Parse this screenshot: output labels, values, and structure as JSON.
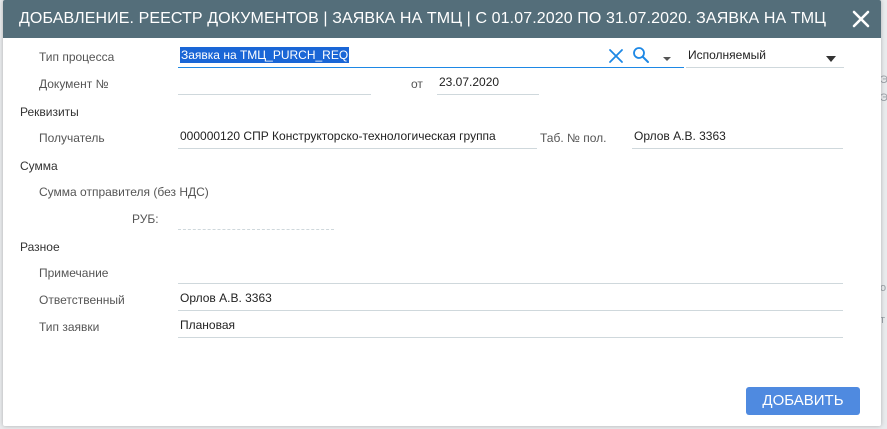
{
  "dialog": {
    "title": "ДОБАВЛЕНИЕ. РЕЕСТР ДОКУМЕНТОВ | ЗАЯВКА НА ТМЦ | С 01.07.2020 ПО 31.07.2020. ЗАЯВКА НА ТМЦ",
    "close_icon": "close-icon"
  },
  "form": {
    "process_type": {
      "label": "Тип процесса",
      "value": "Заявка на ТМЦ_PURCH_REQ",
      "status_value": "Исполняемый"
    },
    "document": {
      "label": "Документ №",
      "value": "",
      "date_label": "от",
      "date_value": "23.07.2020"
    },
    "requisites": {
      "section_label": "Реквизиты",
      "recipient_label": "Получатель",
      "recipient_value": "000000120 СПР Конструкторско-технологическая группа",
      "tab_no_label": "Таб. № пол.",
      "tab_no_value": "Орлов А.В. 3363"
    },
    "amount": {
      "section_label": "Сумма",
      "sender_amount_label": "Сумма отправителя (без НДС)",
      "currency_label": "РУБ:",
      "currency_value": ""
    },
    "misc": {
      "section_label": "Разное",
      "note_label": "Примечание",
      "note_value": "",
      "responsible_label": "Ответственный",
      "responsible_value": "Орлов А.В. 3363",
      "request_type_label": "Тип заявки",
      "request_type_value": "Плановая"
    }
  },
  "footer": {
    "add_button_label": "ДОБАВИТЬ"
  },
  "colors": {
    "titlebar": "#546e7a",
    "accent": "#1e88e5",
    "button": "#4f8ae0",
    "selection": "#1a66d6"
  }
}
